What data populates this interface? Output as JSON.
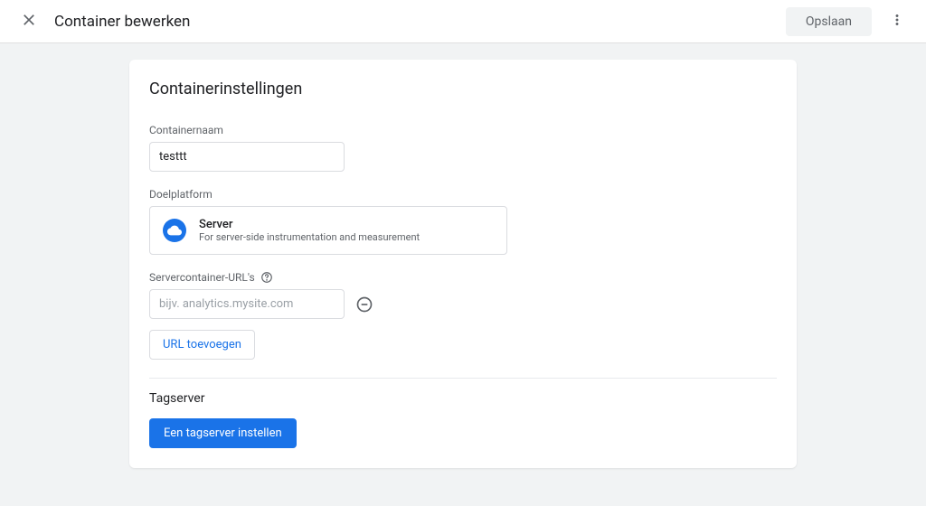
{
  "header": {
    "title": "Container bewerken",
    "save_label": "Opslaan"
  },
  "settings": {
    "title": "Containerinstellingen",
    "container_name_label": "Containernaam",
    "container_name_value": "testtt",
    "platform_label": "Doelplatform",
    "platform": {
      "name": "Server",
      "description": "For server-side instrumentation and measurement"
    },
    "urls_label": "Servercontainer-URL's",
    "url_placeholder": "bijv. analytics.mysite.com",
    "url_value": "",
    "add_url_label": "URL toevoegen"
  },
  "tagserver": {
    "title": "Tagserver",
    "setup_label": "Een tagserver instellen"
  }
}
